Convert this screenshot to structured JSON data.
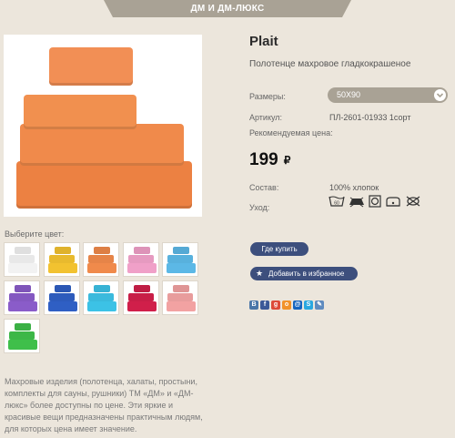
{
  "header": {
    "tab_label": "ДМ И ДМ-ЛЮКС"
  },
  "product": {
    "name": "Plait",
    "subtitle": "Полотенце махровое гладкокрашеное",
    "sizes_label": "Размеры:",
    "size_selected": "50X90",
    "article_label": "Артикул:",
    "article_value": "ПЛ-2601-01933 1сорт",
    "price_label": "Рекомендуемая цена:",
    "price_value": "199",
    "price_currency": "₽",
    "composition_label": "Состав:",
    "composition_value": "100% хлопок",
    "care_label": "Уход:",
    "care_icons": [
      "wash-60-icon",
      "iron-icon",
      "tumble-dry-icon",
      "line-dry-icon",
      "no-bleach-icon"
    ]
  },
  "gallery": {
    "main_color": "#f08a4b",
    "choose_color_label": "Выберите цвет:",
    "swatches": [
      "#f2f2f2",
      "#f2c230",
      "#f08a4b",
      "#f0a0c8",
      "#5cb8e6",
      "#8a5cc9",
      "#2f5fc4",
      "#3cc2e6",
      "#d01f4a",
      "#f2a2a2",
      "#3fbf4a"
    ]
  },
  "actions": {
    "buy_label": "Где купить",
    "favorite_label": "Добавить в избранное"
  },
  "social": [
    {
      "icon": "vk-icon",
      "glyph": "В",
      "color": "#4a76a8"
    },
    {
      "icon": "facebook-icon",
      "glyph": "f",
      "color": "#3b5998"
    },
    {
      "icon": "google-plus-icon",
      "glyph": "g",
      "color": "#dd4b39"
    },
    {
      "icon": "odnoklassniki-icon",
      "glyph": "о",
      "color": "#f2922a"
    },
    {
      "icon": "mail-ru-icon",
      "glyph": "@",
      "color": "#1665c0"
    },
    {
      "icon": "skype-icon",
      "glyph": "S",
      "color": "#2aa8e0"
    },
    {
      "icon": "livejournal-icon",
      "glyph": "✎",
      "color": "#5f8bbf"
    }
  ],
  "description": "Махровые изделия (полотенца, халаты, простыни, комплекты для сауны, рушники) ТМ «ДМ» и «ДМ-люкс» более доступны по цене. Эти яркие и красивые вещи предназначены практичным людям, для которых цена имеет значение."
}
